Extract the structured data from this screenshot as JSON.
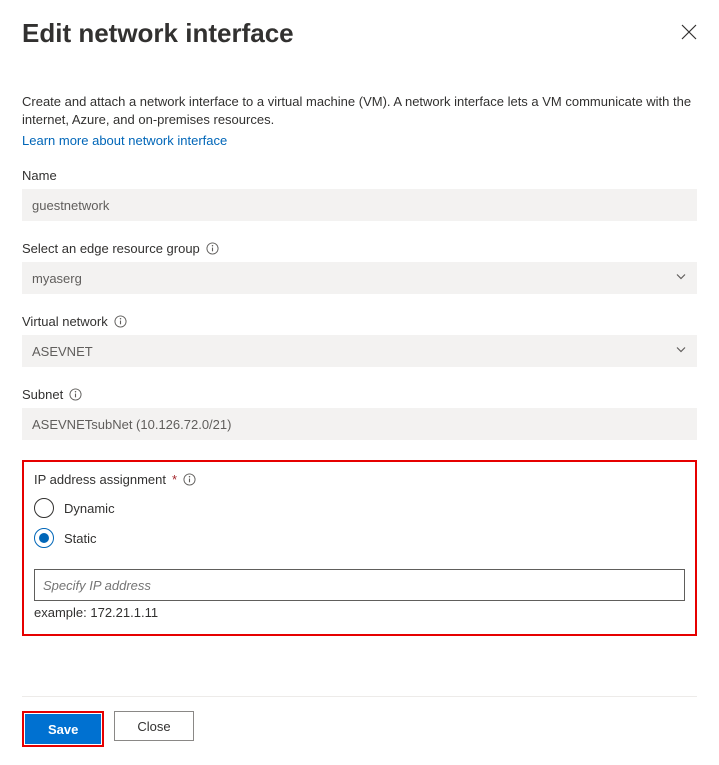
{
  "header": {
    "title": "Edit network interface"
  },
  "intro": {
    "description": "Create and attach a network interface to a virtual machine (VM). A network interface lets a VM communicate with the internet, Azure, and on-premises resources.",
    "learn_link": "Learn more about network interface"
  },
  "fields": {
    "name": {
      "label": "Name",
      "value": "guestnetwork"
    },
    "resource_group": {
      "label": "Select an edge resource group",
      "value": "myaserg"
    },
    "vnet": {
      "label": "Virtual network",
      "value": "ASEVNET"
    },
    "subnet": {
      "label": "Subnet",
      "value": "ASEVNETsubNet (10.126.72.0/21)"
    },
    "ip_assignment": {
      "label": "IP address assignment",
      "options": {
        "dynamic": "Dynamic",
        "static": "Static"
      },
      "selected": "static",
      "ip_placeholder": "Specify IP address",
      "example": "example: 172.21.1.11"
    }
  },
  "footer": {
    "save": "Save",
    "close": "Close"
  }
}
